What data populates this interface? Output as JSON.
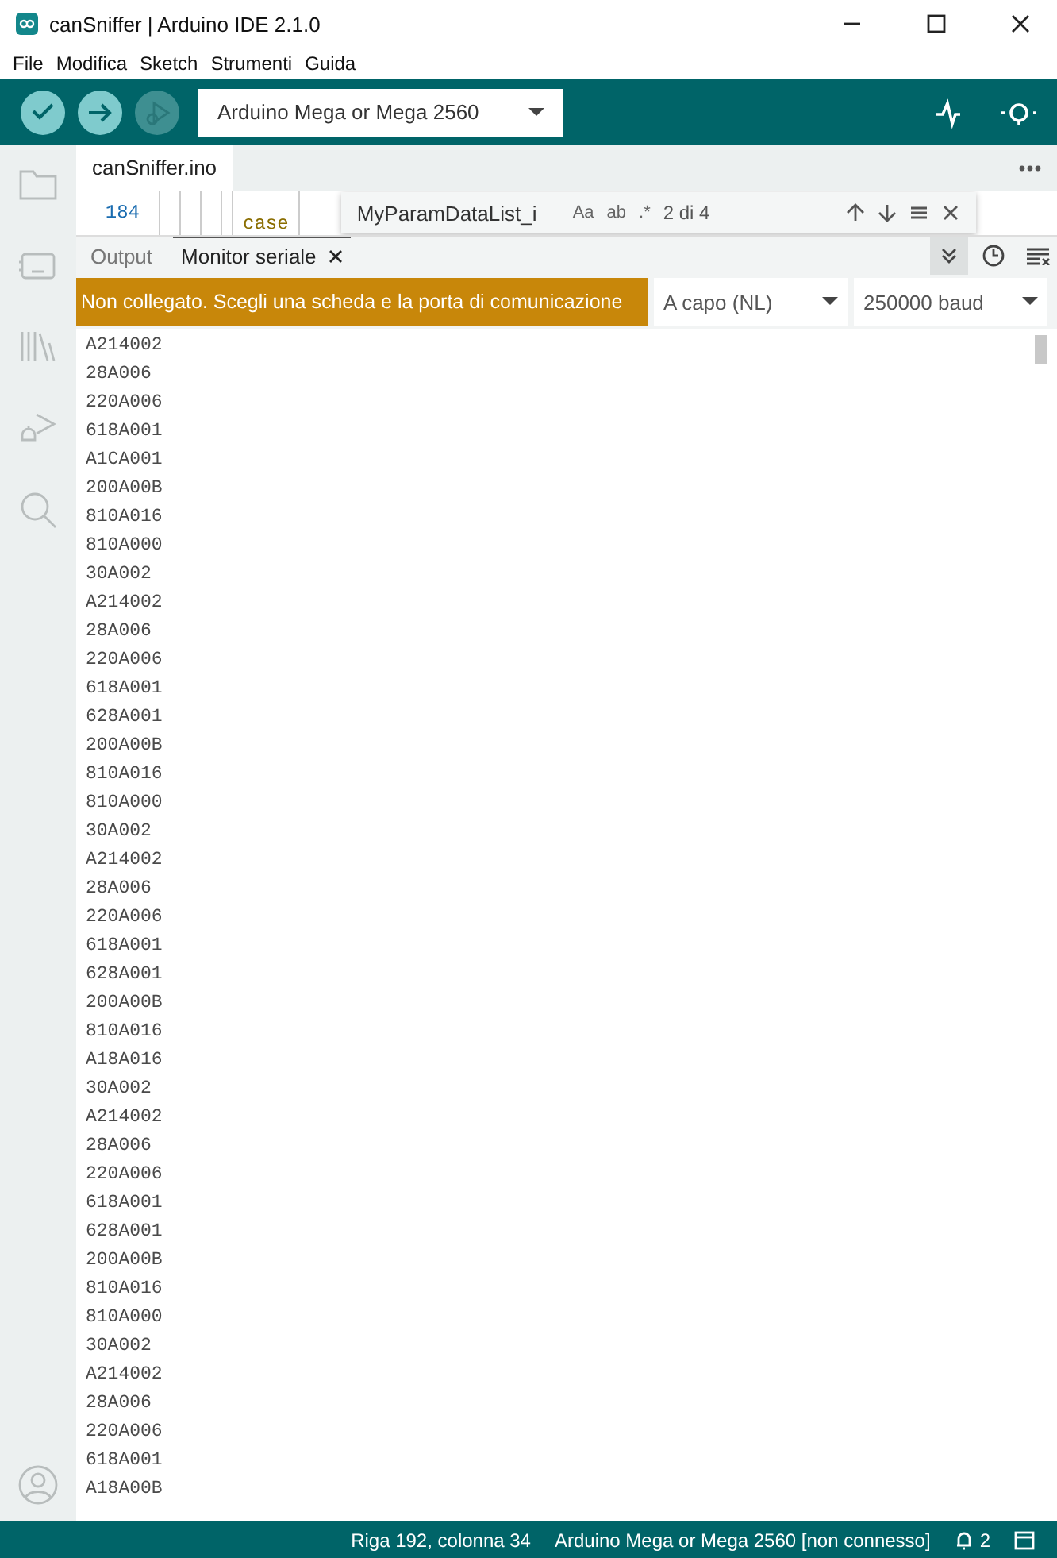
{
  "window": {
    "title": "canSniffer | Arduino IDE 2.1.0"
  },
  "menu": [
    "File",
    "Modifica",
    "Sketch",
    "Strumenti",
    "Guida"
  ],
  "toolbar": {
    "buttons": [
      {
        "kind": "verify",
        "disabled": false
      },
      {
        "kind": "upload",
        "disabled": false
      },
      {
        "kind": "debug",
        "disabled": true
      }
    ],
    "board": "Arduino Mega or Mega 2560"
  },
  "editor": {
    "tabs": [
      {
        "label": "canSniffer.ino",
        "selected": true
      }
    ],
    "line_number": "184",
    "code": "case",
    "find": {
      "value": "MyParamDataList_i",
      "match_case": "Aa",
      "whole_word": "ab",
      "regex": ".*",
      "result": "2 di 4"
    }
  },
  "panel": {
    "tabs": [
      {
        "label": "Output",
        "selected": false
      },
      {
        "label": "Monitor seriale",
        "selected": true
      }
    ],
    "message": "Non collegato. Scegli una scheda e la porta di comunicazione",
    "line_ending": "A capo (NL)",
    "baud": "250000 baud",
    "lines": [
      "A214002",
      "28A006",
      "220A006",
      "618A001",
      "A1CA001",
      "200A00B",
      "810A016",
      "810A000",
      "30A002",
      "A214002",
      "28A006",
      "220A006",
      "618A001",
      "628A001",
      "200A00B",
      "810A016",
      "810A000",
      "30A002",
      "A214002",
      "28A006",
      "220A006",
      "618A001",
      "628A001",
      "200A00B",
      "810A016",
      "A18A016",
      "30A002",
      "A214002",
      "28A006",
      "220A006",
      "618A001",
      "628A001",
      "200A00B",
      "810A016",
      "810A000",
      "30A002",
      "A214002",
      "28A006",
      "220A006",
      "618A001",
      "A18A00B"
    ]
  },
  "status_bar": {
    "position": "Riga 192, colonna 34",
    "board": "Arduino Mega or Mega 2560 [non connesso]",
    "notifications": "2"
  }
}
